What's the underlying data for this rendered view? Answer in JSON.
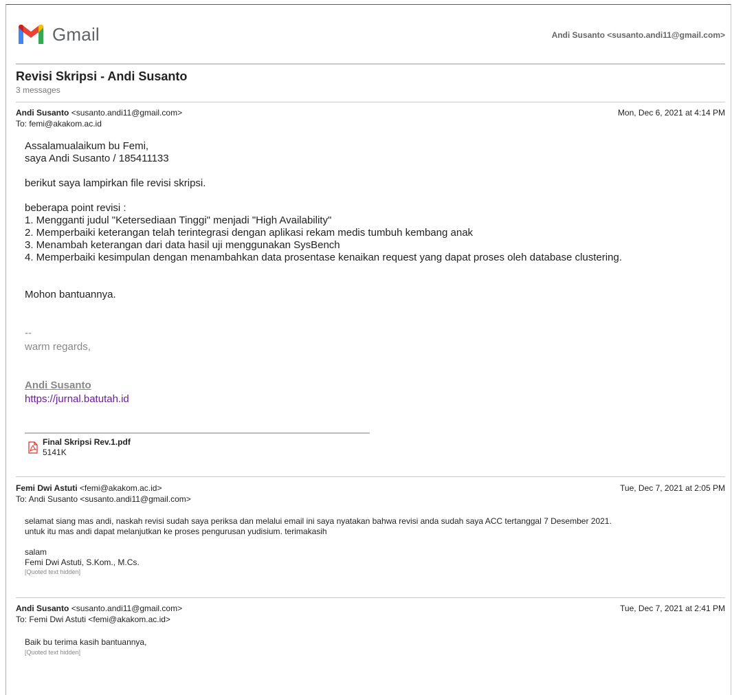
{
  "header": {
    "logo_text": "Gmail",
    "account": "Andi Susanto <susanto.andi11@gmail.com>"
  },
  "thread": {
    "subject": "Revisi Skripsi - Andi Susanto",
    "count": "3 messages"
  },
  "messages": [
    {
      "sender": "Andi Susanto",
      "sender_email": "<susanto.andi11@gmail.com>",
      "date": "Mon, Dec 6, 2021 at 4:14 PM",
      "to": "To: femi@akakom.ac.id",
      "body": {
        "greeting": "Assalamualaikum bu Femi,",
        "intro": "saya Andi Susanto / 185411133",
        "attach_note": "berikut saya lampirkan file revisi skripsi.",
        "points_title": "beberapa point revisi :",
        "points": [
          "1. Mengganti judul \"Ketersediaan Tinggi\" menjadi \"High Availability\"",
          "2. Memperbaiki keterangan telah terintegrasi dengan aplikasi rekam medis tumbuh kembang anak",
          "3. Menambah keterangan dari data hasil uji menggunakan SysBench",
          "4. Memperbaiki kesimpulan dengan menambahkan data prosentase kenaikan request yang dapat proses oleh database clustering."
        ],
        "closing": "Mohon bantuannya.",
        "sig_dash": "--",
        "sig_regards": "warm regards,",
        "sig_name": "Andi Susanto",
        "sig_link": "https://jurnal.batutah.id"
      },
      "attachment": {
        "name": "Final Skripsi Rev.1.pdf",
        "size": "5141K"
      }
    },
    {
      "sender": "Femi Dwi Astuti",
      "sender_email": "<femi@akakom.ac.id>",
      "date": "Tue, Dec 7, 2021 at 2:05 PM",
      "to": "To: Andi Susanto <susanto.andi11@gmail.com>",
      "body": {
        "line1": "selamat siang mas andi, naskah revisi sudah saya periksa dan melalui email ini saya nyatakan bahwa revisi anda sudah saya ACC tertanggal 7 Desember 2021.",
        "line2": "untuk itu mas andi dapat melanjutkan ke proses pengurusan yudisium.  terimakasih",
        "salam": "salam",
        "signer": "Femi Dwi Astuti, S.Kom., M.Cs.",
        "quoted": "[Quoted text hidden]"
      }
    },
    {
      "sender": "Andi Susanto",
      "sender_email": "<susanto.andi11@gmail.com>",
      "date": "Tue, Dec 7, 2021 at 2:41 PM",
      "to": "To: Femi Dwi Astuti <femi@akakom.ac.id>",
      "body": {
        "line1": "Baik bu terima kasih bantuannya,",
        "quoted": "[Quoted text hidden]"
      }
    }
  ],
  "colors": {
    "gmail_red": "#EA4335",
    "gmail_blue": "#4285F4",
    "gmail_green": "#34A853",
    "gmail_yellow": "#FBBC04",
    "link_purple": "#6a1b9a"
  },
  "icons": {
    "logo": "gmail-m-icon",
    "attachment": "pdf-file-icon"
  }
}
